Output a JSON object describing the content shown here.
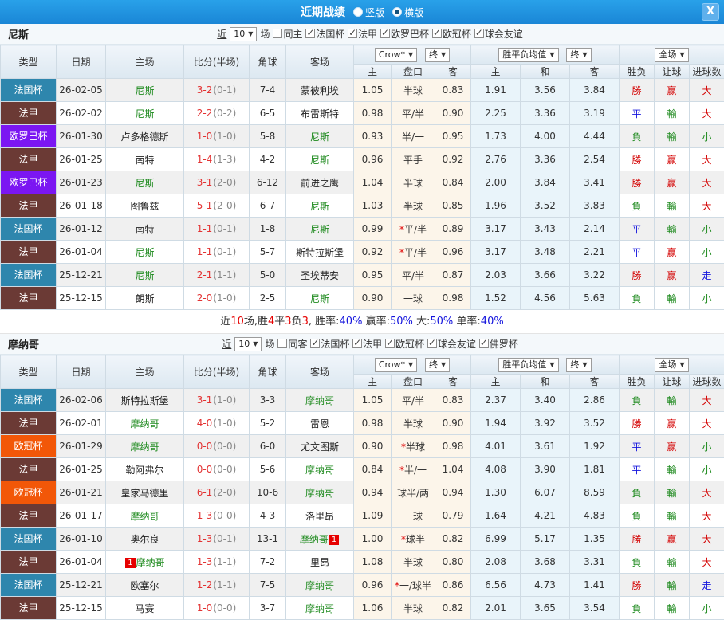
{
  "colors": {
    "topbar_blue": "#1a86d6",
    "league": {
      "法国杯": "#2e86ad",
      "法甲": "#6b3a35",
      "欧罗巴杯": "#7b16f2",
      "欧冠杯": "#f25708"
    },
    "win_red": "#d40000",
    "draw_blue": "#1414dd",
    "loss_green": "#1e8a1e"
  },
  "topbar": {
    "title": "近期战绩",
    "radio_vertical": "竖版",
    "radio_horizontal": "横版",
    "close": "X"
  },
  "table_header": {
    "type": "类型",
    "date": "日期",
    "home": "主场",
    "score": "比分(半场)",
    "corner": "角球",
    "away": "客场",
    "odds_source": "Crow*",
    "final": "终",
    "avg": "胜平负均值",
    "final2": "终",
    "fullmatch": "全场",
    "sub": {
      "home": "主",
      "handicap": "盘口",
      "away": "客",
      "avg_home": "主",
      "avg_draw": "和",
      "avg_away": "客",
      "outcome": "胜负",
      "handicap_result": "让球",
      "goals": "进球数"
    }
  },
  "sections": [
    {
      "team": "尼斯",
      "near": "近",
      "rounds": "10",
      "rounds_suffix": "场",
      "filters": [
        {
          "label": "同主",
          "checked": false
        },
        {
          "label": "法国杯",
          "checked": true
        },
        {
          "label": "法甲",
          "checked": true
        },
        {
          "label": "欧罗巴杯",
          "checked": true
        },
        {
          "label": "欧冠杯",
          "checked": true
        },
        {
          "label": "球会友谊",
          "checked": true
        }
      ],
      "rows": [
        {
          "lg": "法国杯",
          "lgk": "cup-fr",
          "date": "26-02-05",
          "home": "尼斯",
          "home_hl": true,
          "ft": "3-2",
          "ht": "(0-1)",
          "corner": "7-4",
          "away": "蒙彼利埃",
          "o1": "1.05",
          "pk": "半球",
          "o2": "0.83",
          "a1": "1.91",
          "a2": "3.56",
          "a3": "3.84",
          "r1": "勝",
          "r2": "赢",
          "r3": "大"
        },
        {
          "lg": "法甲",
          "lgk": "l1",
          "date": "26-02-02",
          "home": "尼斯",
          "home_hl": true,
          "ft": "2-2",
          "ht": "(0-2)",
          "corner": "6-5",
          "away": "布雷斯特",
          "o1": "0.98",
          "pk": "平/半",
          "o2": "0.90",
          "a1": "2.25",
          "a2": "3.36",
          "a3": "3.19",
          "r1": "平",
          "r2": "輸",
          "r3": "大"
        },
        {
          "lg": "欧罗巴杯",
          "lgk": "el",
          "date": "26-01-30",
          "home": "卢多格德斯",
          "ft": "1-0",
          "ht": "(1-0)",
          "corner": "5-8",
          "away": "尼斯",
          "away_hl": true,
          "o1": "0.93",
          "pk": "半/一",
          "o2": "0.95",
          "a1": "1.73",
          "a2": "4.00",
          "a3": "4.44",
          "r1": "負",
          "r2": "輸",
          "r3": "小"
        },
        {
          "lg": "法甲",
          "lgk": "l1",
          "date": "26-01-25",
          "home": "南特",
          "ft": "1-4",
          "ht": "(1-3)",
          "corner": "4-2",
          "away": "尼斯",
          "away_hl": true,
          "o1": "0.96",
          "pk": "平手",
          "o2": "0.92",
          "a1": "2.76",
          "a2": "3.36",
          "a3": "2.54",
          "r1": "勝",
          "r2": "赢",
          "r3": "大"
        },
        {
          "lg": "欧罗巴杯",
          "lgk": "el",
          "date": "26-01-23",
          "home": "尼斯",
          "home_hl": true,
          "ft": "3-1",
          "ht": "(2-0)",
          "corner": "6-12",
          "away": "前进之鹰",
          "o1": "1.04",
          "pk": "半球",
          "o2": "0.84",
          "a1": "2.00",
          "a2": "3.84",
          "a3": "3.41",
          "r1": "勝",
          "r2": "赢",
          "r3": "大"
        },
        {
          "lg": "法甲",
          "lgk": "l1",
          "date": "26-01-18",
          "home": "图鲁兹",
          "ft": "5-1",
          "ht": "(2-0)",
          "corner": "6-7",
          "away": "尼斯",
          "away_hl": true,
          "o1": "1.03",
          "pk": "半球",
          "o2": "0.85",
          "a1": "1.96",
          "a2": "3.52",
          "a3": "3.83",
          "r1": "負",
          "r2": "輸",
          "r3": "大"
        },
        {
          "lg": "法国杯",
          "lgk": "cup-fr",
          "date": "26-01-12",
          "home": "南特",
          "ft": "1-1",
          "ht": "(0-1)",
          "corner": "1-8",
          "away": "尼斯",
          "away_hl": true,
          "o1": "0.99",
          "star": "*",
          "pk": "平/半",
          "o2": "0.89",
          "a1": "3.17",
          "a2": "3.43",
          "a3": "2.14",
          "r1": "平",
          "r2": "輸",
          "r3": "小"
        },
        {
          "lg": "法甲",
          "lgk": "l1",
          "date": "26-01-04",
          "home": "尼斯",
          "home_hl": true,
          "ft": "1-1",
          "ht": "(0-1)",
          "corner": "5-7",
          "away": "斯特拉斯堡",
          "o1": "0.92",
          "star": "*",
          "pk": "平/半",
          "o2": "0.96",
          "a1": "3.17",
          "a2": "3.48",
          "a3": "2.21",
          "r1": "平",
          "r2": "赢",
          "r3": "小"
        },
        {
          "lg": "法国杯",
          "lgk": "cup-fr",
          "date": "25-12-21",
          "home": "尼斯",
          "home_hl": true,
          "ft": "2-1",
          "ht": "(1-1)",
          "corner": "5-0",
          "away": "圣埃蒂安",
          "o1": "0.95",
          "pk": "平/半",
          "o2": "0.87",
          "a1": "2.03",
          "a2": "3.66",
          "a3": "3.22",
          "r1": "勝",
          "r2": "赢",
          "r3": "走"
        },
        {
          "lg": "法甲",
          "lgk": "l1",
          "date": "25-12-15",
          "home": "朗斯",
          "ft": "2-0",
          "ht": "(1-0)",
          "corner": "2-5",
          "away": "尼斯",
          "away_hl": true,
          "o1": "0.90",
          "pk": "一球",
          "o2": "0.98",
          "a1": "1.52",
          "a2": "4.56",
          "a3": "5.63",
          "r1": "負",
          "r2": "輸",
          "r3": "小"
        }
      ],
      "summary": [
        {
          "t": "近",
          "c": "k"
        },
        {
          "t": "10",
          "c": "r"
        },
        {
          "t": "场,胜",
          "c": "k"
        },
        {
          "t": "4",
          "c": "r"
        },
        {
          "t": "平",
          "c": "k"
        },
        {
          "t": "3",
          "c": "r"
        },
        {
          "t": "负",
          "c": "k"
        },
        {
          "t": "3",
          "c": "r"
        },
        {
          "t": ", 胜率:",
          "c": "k"
        },
        {
          "t": "40%",
          "c": "b"
        },
        {
          "t": " 赢率:",
          "c": "k"
        },
        {
          "t": "50%",
          "c": "b"
        },
        {
          "t": " 大:",
          "c": "k"
        },
        {
          "t": "50%",
          "c": "b"
        },
        {
          "t": " 单率:",
          "c": "k"
        },
        {
          "t": "40%",
          "c": "b"
        }
      ]
    },
    {
      "team": "摩纳哥",
      "near": "近",
      "rounds": "10",
      "rounds_suffix": "场",
      "filters": [
        {
          "label": "同客",
          "checked": false
        },
        {
          "label": "法国杯",
          "checked": true
        },
        {
          "label": "法甲",
          "checked": true
        },
        {
          "label": "欧冠杯",
          "checked": true
        },
        {
          "label": "球会友谊",
          "checked": true
        },
        {
          "label": "佛罗杯",
          "checked": true
        }
      ],
      "rows": [
        {
          "lg": "法国杯",
          "lgk": "cup-fr",
          "date": "26-02-06",
          "home": "斯特拉斯堡",
          "ft": "3-1",
          "ht": "(1-0)",
          "corner": "3-3",
          "away": "摩纳哥",
          "away_hl": true,
          "o1": "1.05",
          "pk": "平/半",
          "o2": "0.83",
          "a1": "2.37",
          "a2": "3.40",
          "a3": "2.86",
          "r1": "負",
          "r2": "輸",
          "r3": "大"
        },
        {
          "lg": "法甲",
          "lgk": "l1",
          "date": "26-02-01",
          "home": "摩纳哥",
          "home_hl": true,
          "ft": "4-0",
          "ht": "(1-0)",
          "corner": "5-2",
          "away": "雷恩",
          "o1": "0.98",
          "pk": "半球",
          "o2": "0.90",
          "a1": "1.94",
          "a2": "3.92",
          "a3": "3.52",
          "r1": "勝",
          "r2": "赢",
          "r3": "大"
        },
        {
          "lg": "欧冠杯",
          "lgk": "ucl",
          "date": "26-01-29",
          "home": "摩纳哥",
          "home_hl": true,
          "ft": "0-0",
          "ht": "(0-0)",
          "corner": "6-0",
          "away": "尤文图斯",
          "o1": "0.90",
          "star": "*",
          "pk": "半球",
          "o2": "0.98",
          "a1": "4.01",
          "a2": "3.61",
          "a3": "1.92",
          "r1": "平",
          "r2": "赢",
          "r3": "小"
        },
        {
          "lg": "法甲",
          "lgk": "l1",
          "date": "26-01-25",
          "home": "勒阿弗尔",
          "ft": "0-0",
          "ht": "(0-0)",
          "corner": "5-6",
          "away": "摩纳哥",
          "away_hl": true,
          "o1": "0.84",
          "star": "*",
          "pk": "半/一",
          "o2": "1.04",
          "a1": "4.08",
          "a2": "3.90",
          "a3": "1.81",
          "r1": "平",
          "r2": "輸",
          "r3": "小"
        },
        {
          "lg": "欧冠杯",
          "lgk": "ucl",
          "date": "26-01-21",
          "home": "皇家马德里",
          "ft": "6-1",
          "ht": "(2-0)",
          "corner": "10-6",
          "away": "摩纳哥",
          "away_hl": true,
          "o1": "0.94",
          "pk": "球半/两",
          "o2": "0.94",
          "a1": "1.30",
          "a2": "6.07",
          "a3": "8.59",
          "r1": "負",
          "r2": "輸",
          "r3": "大"
        },
        {
          "lg": "法甲",
          "lgk": "l1",
          "date": "26-01-17",
          "home": "摩纳哥",
          "home_hl": true,
          "ft": "1-3",
          "ht": "(0-0)",
          "corner": "4-3",
          "away": "洛里昂",
          "o1": "1.09",
          "pk": "一球",
          "o2": "0.79",
          "a1": "1.64",
          "a2": "4.21",
          "a3": "4.83",
          "r1": "負",
          "r2": "輸",
          "r3": "大"
        },
        {
          "lg": "法国杯",
          "lgk": "cup-fr",
          "date": "26-01-10",
          "home": "奥尔良",
          "ft": "1-3",
          "ht": "(0-1)",
          "corner": "13-1",
          "away": "摩纳哥",
          "away_hl": true,
          "away_b2": "1",
          "o1": "1.00",
          "star": "*",
          "pk": "球半",
          "o2": "0.82",
          "a1": "6.99",
          "a2": "5.17",
          "a3": "1.35",
          "r1": "勝",
          "r2": "赢",
          "r3": "大"
        },
        {
          "lg": "法甲",
          "lgk": "l1",
          "date": "26-01-04",
          "home": "摩纳哥",
          "home_hl": true,
          "home_b1": "1",
          "ft": "1-3",
          "ht": "(1-1)",
          "corner": "7-2",
          "away": "里昂",
          "o1": "1.08",
          "pk": "半球",
          "o2": "0.80",
          "a1": "2.08",
          "a2": "3.68",
          "a3": "3.31",
          "r1": "負",
          "r2": "輸",
          "r3": "大"
        },
        {
          "lg": "法国杯",
          "lgk": "cup-fr",
          "date": "25-12-21",
          "home": "欧塞尔",
          "ft": "1-2",
          "ht": "(1-1)",
          "corner": "7-5",
          "away": "摩纳哥",
          "away_hl": true,
          "o1": "0.96",
          "star": "*",
          "pk": "一/球半",
          "o2": "0.86",
          "a1": "6.56",
          "a2": "4.73",
          "a3": "1.41",
          "r1": "勝",
          "r2": "輸",
          "r3": "走"
        },
        {
          "lg": "法甲",
          "lgk": "l1",
          "date": "25-12-15",
          "home": "马赛",
          "ft": "1-0",
          "ht": "(0-0)",
          "corner": "3-7",
          "away": "摩纳哥",
          "away_hl": true,
          "o1": "1.06",
          "pk": "半球",
          "o2": "0.82",
          "a1": "2.01",
          "a2": "3.65",
          "a3": "3.54",
          "r1": "負",
          "r2": "輸",
          "r3": "小"
        }
      ]
    }
  ]
}
